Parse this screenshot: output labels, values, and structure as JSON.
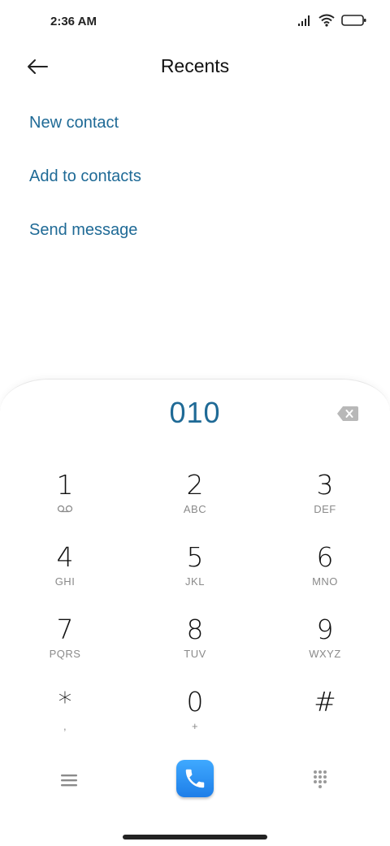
{
  "status_bar": {
    "time": "2:36 AM"
  },
  "header": {
    "title": "Recents"
  },
  "options": [
    {
      "label": "New contact"
    },
    {
      "label": "Add to contacts"
    },
    {
      "label": "Send message"
    }
  ],
  "dialer": {
    "number": "010",
    "keys": [
      {
        "digit": "1",
        "letters": ""
      },
      {
        "digit": "2",
        "letters": "ABC"
      },
      {
        "digit": "3",
        "letters": "DEF"
      },
      {
        "digit": "4",
        "letters": "GHI"
      },
      {
        "digit": "5",
        "letters": "JKL"
      },
      {
        "digit": "6",
        "letters": "MNO"
      },
      {
        "digit": "7",
        "letters": "PQRS"
      },
      {
        "digit": "8",
        "letters": "TUV"
      },
      {
        "digit": "9",
        "letters": "WXYZ"
      },
      {
        "digit": "*",
        "letters": ","
      },
      {
        "digit": "0",
        "letters": "+"
      },
      {
        "digit": "#",
        "letters": ""
      }
    ]
  },
  "icons": {
    "status": [
      "signal-icon",
      "wifi-icon",
      "battery-icon"
    ],
    "back": "arrow-left-icon",
    "backspace": "backspace-icon",
    "voicemail": "voicemail-icon",
    "menu": "menu-icon",
    "call": "phone-icon",
    "keypad": "dialpad-icon"
  },
  "colors": {
    "accent": "#1f6a96",
    "call_button": "#2a8ff2",
    "secondary_text": "#8a8a8a"
  }
}
